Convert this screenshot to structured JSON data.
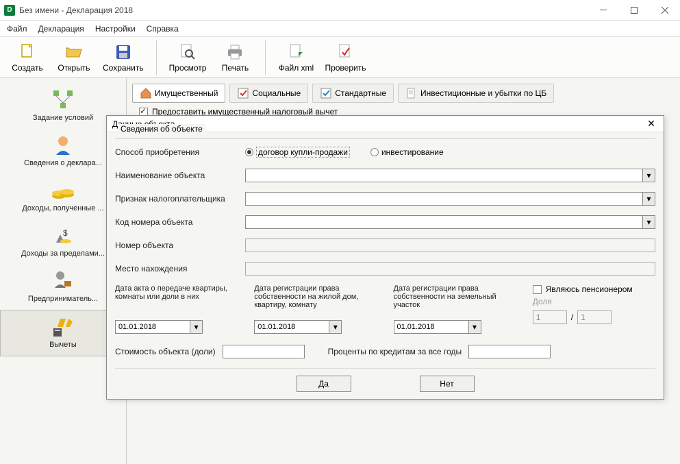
{
  "title": "Без имени - Декларация 2018",
  "menu": {
    "file": "Файл",
    "decl": "Декларация",
    "settings": "Настройки",
    "help": "Справка"
  },
  "toolbar": {
    "create": "Создать",
    "open": "Открыть",
    "save": "Сохранить",
    "preview": "Просмотр",
    "print": "Печать",
    "xml": "Файл xml",
    "check": "Проверить"
  },
  "nav": {
    "conditions": "Задание условий",
    "declarant": "Сведения о деклара...",
    "income": "Доходы, полученные ...",
    "abroad": "Доходы за пределами...",
    "business": "Предприниматель...",
    "deductions": "Вычеты"
  },
  "tabs": {
    "property": "Имущественный",
    "social": "Социальные",
    "standard": "Стандартные",
    "invest": "Инвестиционные и убытки по ЦБ"
  },
  "checkbox_provide": "Предоставить имущественный налоговый вычет",
  "modal": {
    "title": "Данные объекта",
    "fieldset": "Сведения об объекте",
    "acq_method": "Способ приобретения",
    "radio1": "договор купли-продажи",
    "radio2": "инвестирование",
    "obj_name": "Наименование объекта",
    "taxpayer_sign": "Признак налогоплательщика",
    "code": "Код номера объекта",
    "number": "Номер объекта",
    "location": "Место нахождения",
    "date1_label": "Дата акта о передаче квартиры, комнаты или доли в них",
    "date2_label": "Дата регистрации права собственности на жилой дом, квартиру, комнату",
    "date3_label": "Дата регистрации права собственности на земельный участок",
    "pensioner": "Являюсь пенсионером",
    "share": "Доля",
    "date_value": "01.01.2018",
    "share_n": "1",
    "share_d": "1",
    "cost": "Стоимость объекта (доли)",
    "percent": "Проценты по кредитам за все годы",
    "yes": "Да",
    "no": "Нет"
  }
}
